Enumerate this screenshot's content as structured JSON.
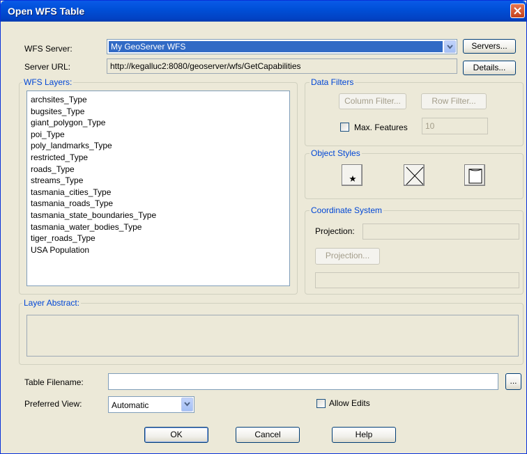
{
  "window": {
    "title": "Open WFS Table"
  },
  "server": {
    "label": "WFS Server:",
    "value": "My GeoServer WFS",
    "servers_button": "Servers...",
    "url_label": "Server URL:",
    "url": "http://kegalluc2:8080/geoserver/wfs/GetCapabilities",
    "details_button": "Details..."
  },
  "layers": {
    "title": "WFS Layers:",
    "items": [
      "archsites_Type",
      "bugsites_Type",
      "giant_polygon_Type",
      "poi_Type",
      "poly_landmarks_Type",
      "restricted_Type",
      "roads_Type",
      "streams_Type",
      "tasmania_cities_Type",
      "tasmania_roads_Type",
      "tasmania_state_boundaries_Type",
      "tasmania_water_bodies_Type",
      "tiger_roads_Type",
      "USA Population"
    ]
  },
  "filters": {
    "title": "Data Filters",
    "column_button": "Column Filter...",
    "row_button": "Row Filter...",
    "max_features_label": "Max. Features",
    "max_features_value": "10"
  },
  "styles": {
    "title": "Object Styles"
  },
  "coords": {
    "title": "Coordinate System",
    "projection_label": "Projection:",
    "projection_button": "Projection..."
  },
  "abstract": {
    "title": "Layer Abstract:"
  },
  "table": {
    "filename_label": "Table Filename:",
    "browse_button": "..."
  },
  "view": {
    "label": "Preferred View:",
    "value": "Automatic"
  },
  "allow_edits": {
    "label": "Allow Edits"
  },
  "buttons": {
    "ok": "OK",
    "cancel": "Cancel",
    "help": "Help"
  }
}
